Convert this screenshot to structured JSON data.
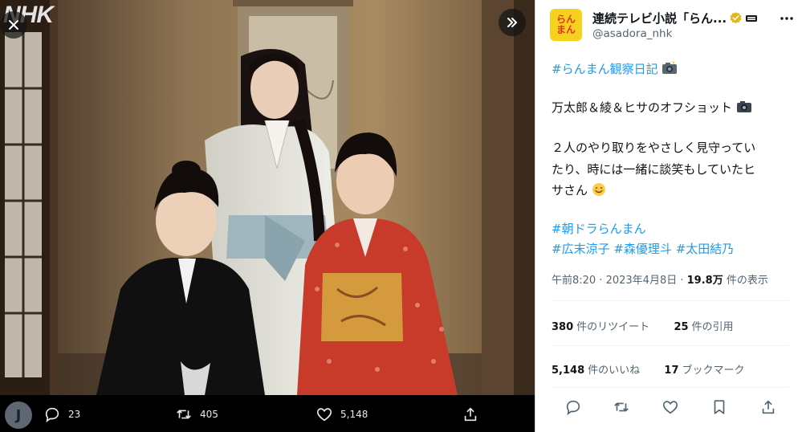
{
  "media": {
    "watermark": "NHK",
    "badge": "J",
    "actions": {
      "reply_count": "23",
      "retweet_count": "405",
      "like_count": "5,148"
    }
  },
  "tweet": {
    "avatar_text_1": "らん",
    "avatar_text_2": "まん",
    "name": "連続テレビ小説「らん...",
    "handle": "@asadora_nhk",
    "hashtag_1": "#らんまん観察日記",
    "line_1": "万太郎＆綾＆ヒサのオフショット",
    "line_2": "２人のやり取りをやさしく見守ってい",
    "line_3": "たり、時には一緒に談笑もしていたヒ",
    "line_4": "サさん",
    "hashtag_2": "#朝ドラらんまん",
    "hashtag_3": "#広末涼子",
    "hashtag_4": "#森優理斗",
    "hashtag_5": "#太田結乃",
    "time": "午前8:20 · 2023年4月8日 · ",
    "views_count": "19.8万",
    "views_label": " 件の表示",
    "retweets": "380",
    "retweets_label": "件のリツイート",
    "quotes": "25",
    "quotes_label": "件の引用",
    "likes": "5,148",
    "likes_label": "件のいいね",
    "bookmarks": "17",
    "bookmarks_label": "ブックマーク"
  },
  "colors": {
    "link": "#1d9bf0",
    "text": "#0f1419",
    "muted": "#536471",
    "verified": "#e2b719"
  }
}
